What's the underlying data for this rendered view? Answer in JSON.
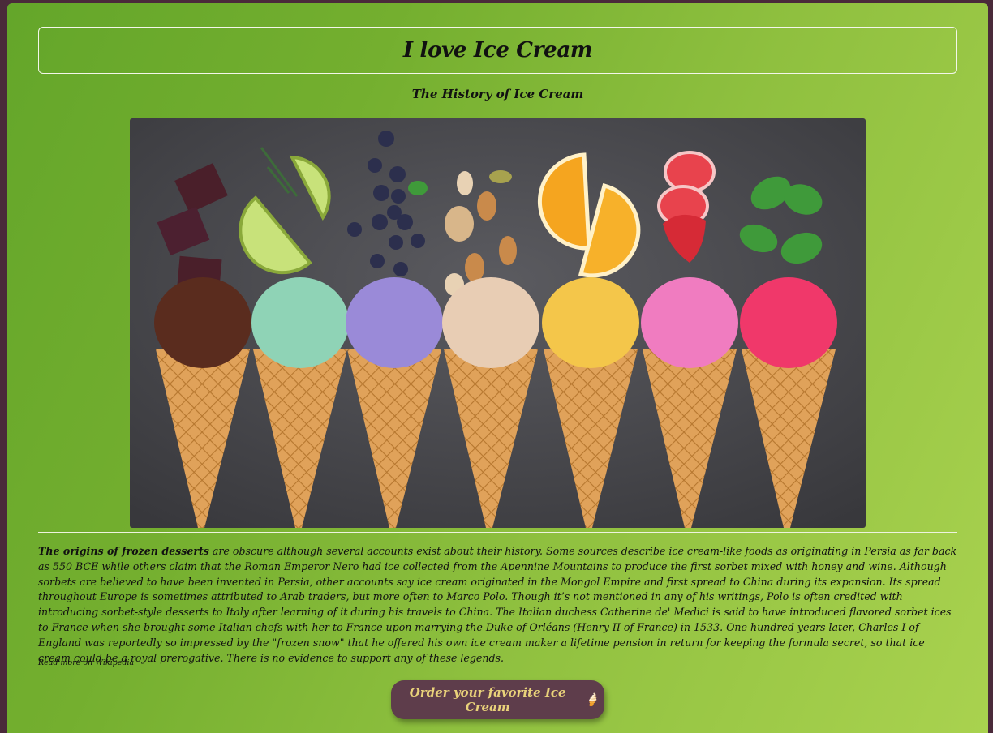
{
  "header": {
    "title": "I love Ice Cream",
    "subtitle": "The History of Ice Cream"
  },
  "hero_image": {
    "icon": "ice-cream-cones-photo"
  },
  "article": {
    "lead": "The origins of frozen desserts",
    "body": " are obscure although several accounts exist about their history. Some sources describe ice cream-like foods as originating in Persia as far back as 550 BCE while others claim that the Roman Emperor Nero had ice collected from the Apennine Mountains to produce the first sorbet mixed with honey and wine. Although sorbets are believed to have been invented in Persia, other accounts say ice cream originated in the Mongol Empire and first spread to China during its expansion. Its spread throughout Europe is sometimes attributed to Arab traders, but more often to Marco Polo. Though it’s not mentioned in any of his writings, Polo is often credited with introducing sorbet-style desserts to Italy after learning of it during his travels to China. The Italian duchess Catherine de' Medici is said to have introduced flavored sorbet ices to France when she brought some Italian chefs with her to France upon marrying the Duke of Orléans (Henry II of France) in 1533. One hundred years later, Charles I of England was reportedly so impressed by the \"frozen snow\" that he offered his own ice cream maker a lifetime pension in return for keeping the formula secret, so that ice cream could be a royal prerogative. There is no evidence to support any of these legends.",
    "more_link": "Read more on Wikipedia"
  },
  "order_button": {
    "label": "Order your favorite Ice Cream",
    "icon_glyph": "🍦",
    "icon": "ice-cream-icon"
  },
  "colors": {
    "background_start": "#64a62a",
    "background_end": "#a9d24f",
    "button_bg": "#5e3d4b",
    "button_text": "#e9d27a",
    "frame": "#4a2a3a"
  }
}
